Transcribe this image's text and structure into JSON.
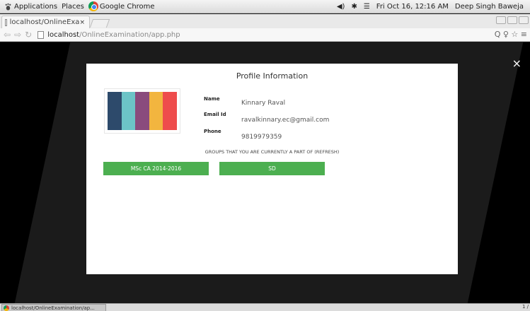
{
  "topbar": {
    "applications": "Applications",
    "places": "Places",
    "app_name": "Google Chrome",
    "volume": "◀)",
    "bluetooth": "✱",
    "wifi": "☰",
    "clock": "Fri Oct 16, 12:16 AM",
    "user": "Deep Singh Baweja"
  },
  "browser": {
    "tab_title": "localhost/OnlineExa",
    "tab_close": "×",
    "url_host": "localhost",
    "url_path": "/OnlineExamination/app.php",
    "toolbar_right": "Q ♀ ☆ ≡"
  },
  "modal": {
    "close": "×",
    "title": "Profile Information",
    "name_label": "Name",
    "name_value": "Kinnary Raval",
    "email_label": "Email Id",
    "email_value": "ravalkinnary.ec@gmail.com",
    "phone_label": "Phone",
    "phone_value": "9819979359",
    "groups_heading": "GROUPS THAT YOU ARE CURRENTLY A PART OF (REFRESH)",
    "groups": [
      "MSc CA 2014-2016",
      "SD"
    ],
    "photo_colors": [
      "#2d4a6b",
      "#6cc4c7",
      "#8a4b7d",
      "#f2b53f",
      "#ee4c4c"
    ],
    "button_color": "#4caf50"
  },
  "taskbar": {
    "window_label": "localhost/OnlineExamination/ap...",
    "pager": "1 /"
  }
}
